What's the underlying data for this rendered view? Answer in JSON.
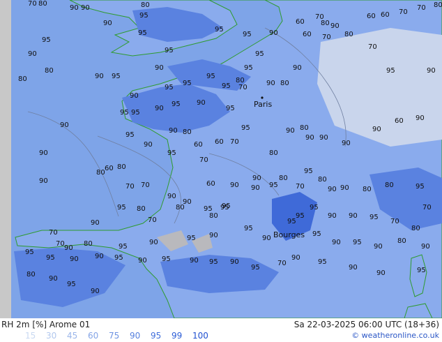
{
  "title": {
    "left": "RH 2m [%] Arome 01",
    "right": "Sa 22-03-2025 06:00 UTC (18+36)"
  },
  "credit": "© weatheronline.co.uk",
  "legend": [
    {
      "label": "15",
      "color": "#c9d9f2"
    },
    {
      "label": "30",
      "color": "#b2c8ee"
    },
    {
      "label": "45",
      "color": "#9bb6ea"
    },
    {
      "label": "60",
      "color": "#84a4e6"
    },
    {
      "label": "75",
      "color": "#6d92e2"
    },
    {
      "label": "90",
      "color": "#5680de"
    },
    {
      "label": "95",
      "color": "#406edb"
    },
    {
      "label": "99",
      "color": "#2b5cd6"
    },
    {
      "label": "100",
      "color": "#2050d0"
    }
  ],
  "colors": {
    "sea": "#7ea4e8",
    "land_base": "#8aabed",
    "humid_95": "#5a82e0",
    "humid_99": "#3f6ad8",
    "drier": "#c9d5ec",
    "dry_grey": "#b9b9bd",
    "coast": "#2e9b2e",
    "grid_edge": "#c8c8c8"
  },
  "cities": [
    {
      "name": "Paris"
    },
    {
      "name": "Bourges"
    }
  ],
  "map_labels": [
    "70",
    "80",
    "90",
    "80",
    "90",
    "95",
    "90",
    "95",
    "95",
    "95",
    "95",
    "60",
    "70",
    "80",
    "90",
    "60",
    "70",
    "80",
    "60",
    "60",
    "70",
    "70",
    "80",
    "95",
    "90",
    "95",
    "90",
    "95",
    "95",
    "95",
    "95",
    "80",
    "70",
    "80",
    "90",
    "70",
    "95",
    "90",
    "95",
    "90",
    "80",
    "80",
    "95",
    "90",
    "90",
    "90",
    "95",
    "90",
    "95",
    "95",
    "95",
    "90",
    "95",
    "90",
    "80",
    "90",
    "90",
    "95",
    "90",
    "80",
    "90",
    "60",
    "60",
    "70",
    "70",
    "80",
    "90",
    "90",
    "95",
    "80",
    "60",
    "80",
    "70",
    "70",
    "90",
    "90",
    "60",
    "90",
    "90",
    "80",
    "95",
    "90",
    "90",
    "60",
    "90",
    "90",
    "80",
    "95",
    "70",
    "90",
    "80",
    "95",
    "95",
    "90",
    "95",
    "70",
    "80",
    "90",
    "90",
    "80",
    "80",
    "95",
    "80",
    "95",
    "95",
    "95",
    "95",
    "90",
    "90",
    "95",
    "70",
    "80",
    "70",
    "70",
    "70",
    "90",
    "80",
    "95",
    "90",
    "95",
    "90",
    "95",
    "90",
    "95",
    "90",
    "95",
    "90",
    "80",
    "90",
    "95",
    "95",
    "90",
    "90",
    "95",
    "90",
    "95",
    "90",
    "95",
    "90",
    "95",
    "70",
    "90",
    "95",
    "90",
    "90",
    "95",
    "80",
    "90",
    "95",
    "90"
  ]
}
